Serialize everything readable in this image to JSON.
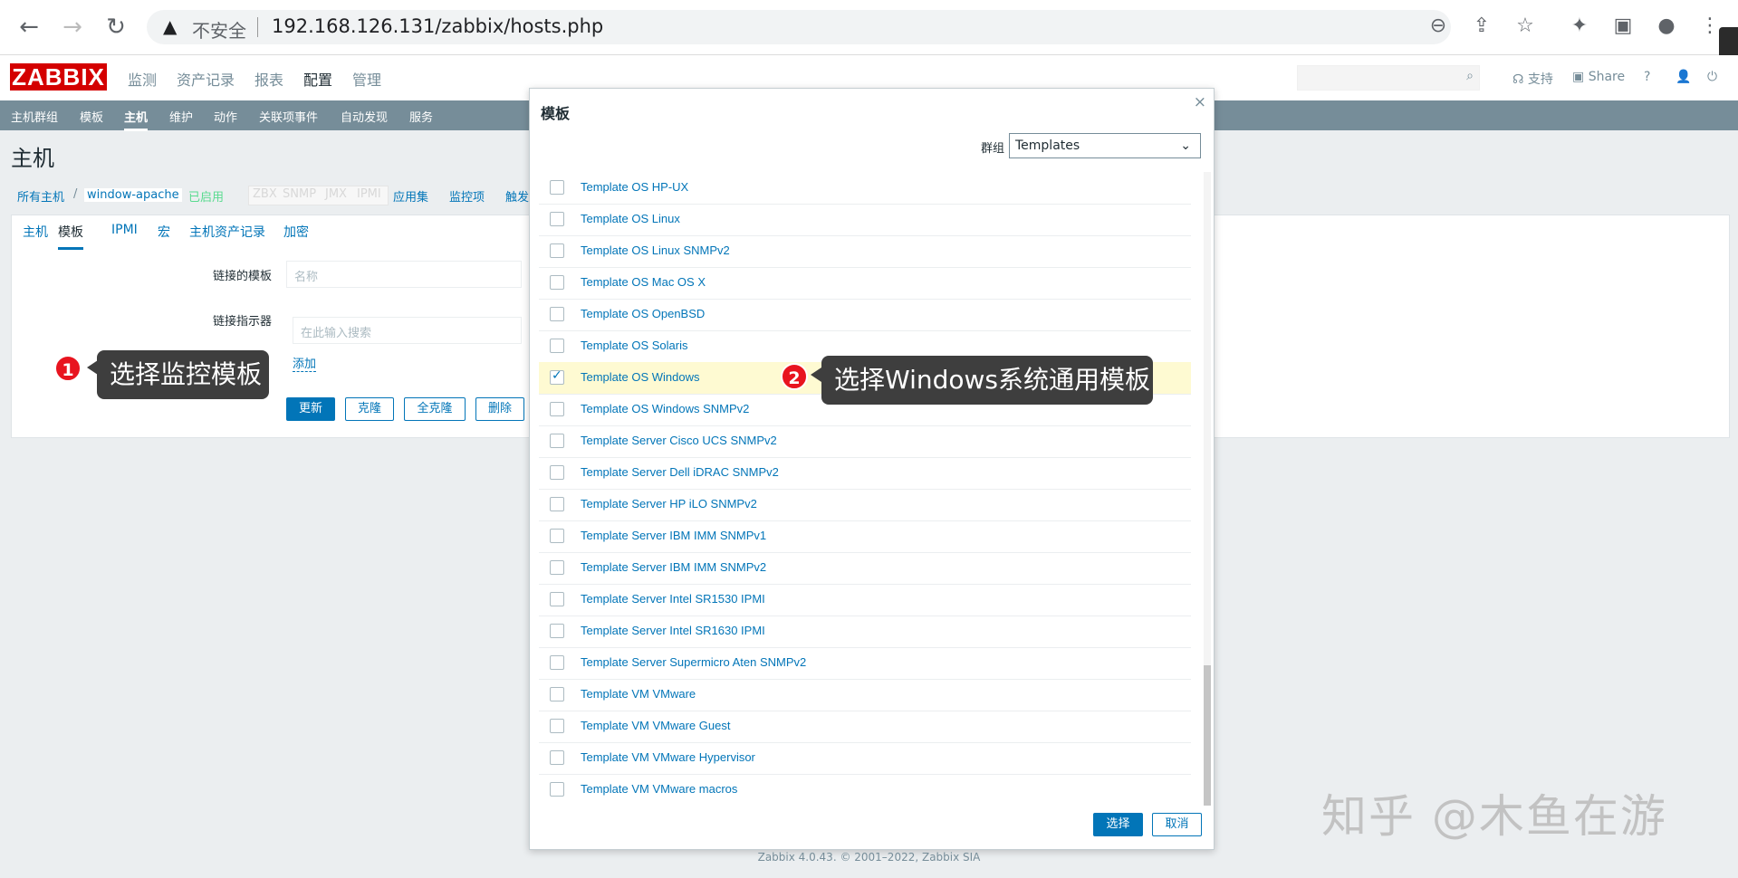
{
  "browser": {
    "insecure_label": "不安全",
    "url": "192.168.126.131/zabbix/hosts.php",
    "back_icon": "back-arrow-icon",
    "forward_icon": "forward-arrow-icon",
    "reload_icon": "reload-icon"
  },
  "header": {
    "logo": "ZABBIX",
    "menu": [
      "监测",
      "资产记录",
      "报表",
      "配置",
      "管理"
    ],
    "active_menu": "配置",
    "support_label": "支持",
    "share_label": "Share",
    "help_label": "?"
  },
  "submenu": [
    "主机群组",
    "模板",
    "主机",
    "维护",
    "动作",
    "关联项事件",
    "自动发现",
    "服务"
  ],
  "page": {
    "title": "主机",
    "breadcrumbs": {
      "all_hosts": "所有主机",
      "separator": "/",
      "host": "window-apache",
      "enabled": "已启用",
      "zbx": "ZBX",
      "snmp": "SNMP",
      "jmx": "JMX",
      "ipmi": "IPMI",
      "apps": "应用集",
      "items": "监控项",
      "triggers": "触发"
    },
    "tabs": [
      "主机",
      "模板",
      "IPMI",
      "宏",
      "主机资产记录",
      "加密"
    ],
    "active_tab": "模板",
    "linked_templates_label": "链接的模板",
    "name_placeholder": "名称",
    "link_indicator_label": "链接指示器",
    "search_placeholder": "在此输入搜索",
    "add_link": "添加",
    "buttons": {
      "update": "更新",
      "clone": "克隆",
      "full_clone": "全克隆",
      "delete": "删除"
    }
  },
  "callouts": [
    {
      "number": "1",
      "text": "选择监控模板"
    },
    {
      "number": "2",
      "text": "选择Windows系统通用模板"
    }
  ],
  "modal": {
    "title": "模板",
    "group_label": "群组",
    "group_value": "Templates",
    "items": [
      {
        "label": "Template OS HP-UX",
        "checked": false
      },
      {
        "label": "Template OS Linux",
        "checked": false
      },
      {
        "label": "Template OS Linux SNMPv2",
        "checked": false
      },
      {
        "label": "Template OS Mac OS X",
        "checked": false
      },
      {
        "label": "Template OS OpenBSD",
        "checked": false
      },
      {
        "label": "Template OS Solaris",
        "checked": false
      },
      {
        "label": "Template OS Windows",
        "checked": true
      },
      {
        "label": "Template OS Windows SNMPv2",
        "checked": false
      },
      {
        "label": "Template Server Cisco UCS SNMPv2",
        "checked": false
      },
      {
        "label": "Template Server Dell iDRAC SNMPv2",
        "checked": false
      },
      {
        "label": "Template Server HP iLO SNMPv2",
        "checked": false
      },
      {
        "label": "Template Server IBM IMM SNMPv1",
        "checked": false
      },
      {
        "label": "Template Server IBM IMM SNMPv2",
        "checked": false
      },
      {
        "label": "Template Server Intel SR1530 IPMI",
        "checked": false
      },
      {
        "label": "Template Server Intel SR1630 IPMI",
        "checked": false
      },
      {
        "label": "Template Server Supermicro Aten SNMPv2",
        "checked": false
      },
      {
        "label": "Template VM VMware",
        "checked": false
      },
      {
        "label": "Template VM VMware Guest",
        "checked": false
      },
      {
        "label": "Template VM VMware Hypervisor",
        "checked": false
      },
      {
        "label": "Template VM VMware macros",
        "checked": false
      }
    ],
    "select_button": "选择",
    "cancel_button": "取消"
  },
  "footer": "Zabbix 4.0.43. © 2001–2022, Zabbix SIA",
  "watermark": "知乎 @木鱼在游",
  "colors": {
    "accent": "#0275b8",
    "brand": "#d40000",
    "submenu_bg": "#768d99",
    "selected_row": "#fefad2",
    "badge": "#e8141f"
  }
}
